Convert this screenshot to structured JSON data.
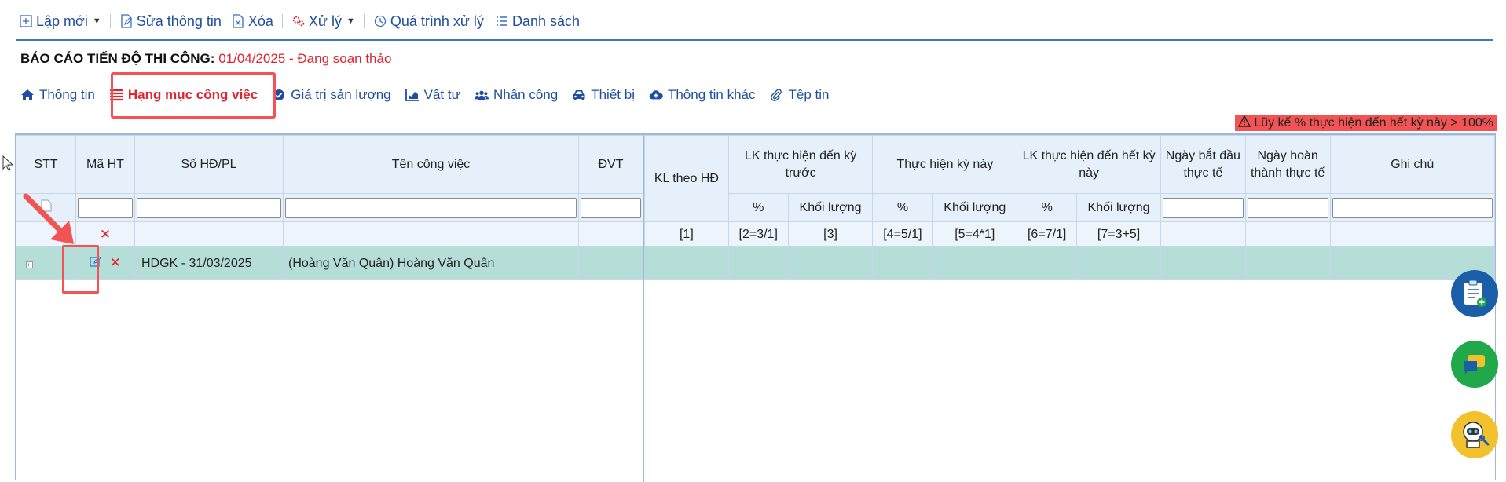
{
  "toolbar": {
    "new_label": "Lập mới",
    "edit_info_label": "Sửa thông tin",
    "delete_label": "Xóa",
    "process_label": "Xử lý",
    "history_label": "Quá trình xử lý",
    "list_label": "Danh sách"
  },
  "report": {
    "title_label": "BÁO CÁO TIẾN ĐỘ THI CÔNG:",
    "title_value": "01/04/2025 - Đang soạn thảo"
  },
  "tabs": [
    {
      "label": "Thông tin",
      "icon": "home-icon"
    },
    {
      "label": "Hạng mục công việc",
      "icon": "list-icon",
      "active": true
    },
    {
      "label": "Giá trị sản lượng",
      "icon": "check-circle-icon"
    },
    {
      "label": "Vật tư",
      "icon": "bar-chart-icon"
    },
    {
      "label": "Nhân công",
      "icon": "users-icon"
    },
    {
      "label": "Thiết bị",
      "icon": "car-icon"
    },
    {
      "label": "Thông tin khác",
      "icon": "cloud-upload-icon"
    },
    {
      "label": "Tệp tin",
      "icon": "paperclip-icon"
    }
  ],
  "warning": {
    "text": "Lũy kế % thực hiện đến hết kỳ này > 100%",
    "color": "#f25354"
  },
  "grid": {
    "left_headers": [
      "STT",
      "Mã HT",
      "Số HĐ/PL",
      "Tên công việc",
      "ĐVT"
    ],
    "right_headers": {
      "kl_theo_hd": "KL theo HĐ",
      "lk_truoc": "LK thực hiện đến kỳ trước",
      "th_ky_nay": "Thực hiện kỳ này",
      "lk_het_ky": "LK thực hiện đến hết kỳ này",
      "ngay_bat_dau": "Ngày bắt đầu thực tế",
      "ngay_hoan_thanh": "Ngày hoàn thành thực tế",
      "ghi_chu": "Ghi chú"
    },
    "sub_headers": {
      "pct": "%",
      "qty": "Khối lượng"
    },
    "formulas": [
      "[1]",
      "[2=3/1]",
      "[3]",
      "[4=5/1]",
      "[5=4*1]",
      "[6=7/1]",
      "[7=3+5]"
    ],
    "rows": [
      {
        "contract": "HDGK - 31/03/2025",
        "work_name": "(Hoàng Văn Quân) Hoàng Văn Quân"
      }
    ]
  },
  "colors": {
    "accent": "#1f4ea0",
    "alert": "#e0242f",
    "row_highlight": "#b6ded9",
    "header_bg": "#e6f0fb"
  }
}
